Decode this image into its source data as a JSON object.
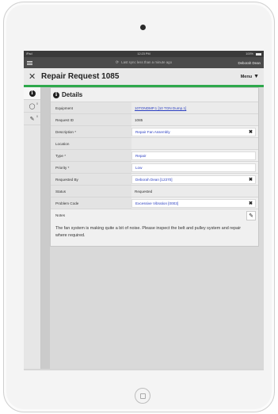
{
  "statusbar": {
    "carrier": "iPad",
    "time": "12:23 PM",
    "battery": "100%"
  },
  "appbar": {
    "sync_text": "Last sync less than a minute ago",
    "user": "Deborah Dean"
  },
  "header": {
    "title": "Repair Request 1085",
    "menu_label": "Menu"
  },
  "sidebar": {
    "items": [
      {
        "icon": "info-icon",
        "badge": ""
      },
      {
        "icon": "comment-icon",
        "badge": "0"
      },
      {
        "icon": "attachment-icon",
        "badge": "0"
      }
    ]
  },
  "details": {
    "heading": "Details",
    "fields": [
      {
        "label": "Equipment",
        "value": "10TONDMP.1 [10 TON Dump.1]"
      },
      {
        "label": "Request ID",
        "value": "1085"
      },
      {
        "label": "Description *",
        "value": "Repair Fan Assembly"
      },
      {
        "label": "Location",
        "value": ""
      },
      {
        "label": "Type *",
        "value": "Repair"
      },
      {
        "label": "Priority *",
        "value": "Low"
      },
      {
        "label": "Requested By",
        "value": "Deborah Dean [12370]"
      },
      {
        "label": "Status",
        "value": "Requested"
      },
      {
        "label": "Problem Code",
        "value": "Excessive Vibration [0003]"
      }
    ],
    "notes_label": "Notes",
    "notes_text": "The fan system is making quite a bit of noise. Please inspect the belt and pulley system and repair where required."
  },
  "colors": {
    "accent": "#2ea84c",
    "link": "#2b3fc1"
  }
}
